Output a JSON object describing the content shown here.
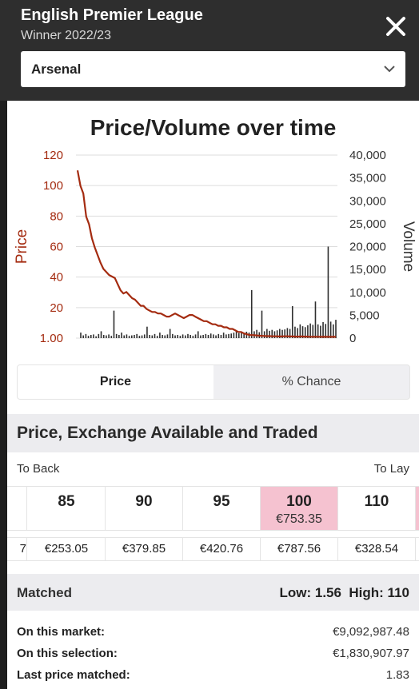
{
  "header": {
    "title": "English Premier League",
    "subtitle": "Winner 2022/23",
    "close_icon": "close-icon",
    "selection": "Arsenal",
    "dropdown_icon": "chevron-down-icon"
  },
  "chart_data": {
    "type": "line",
    "title": "Price/Volume over time",
    "ylabel": "Price",
    "y2label": "Volume",
    "y_ticks": [
      "120",
      "100",
      "80",
      "60",
      "40",
      "20",
      "1.00"
    ],
    "y2_ticks": [
      "40,000",
      "35,000",
      "30,000",
      "25,000",
      "20,000",
      "15,000",
      "10,000",
      "5,000",
      "0"
    ],
    "ylim": [
      1,
      120
    ],
    "y2lim": [
      0,
      40000
    ],
    "grid": true,
    "colors": {
      "price": "#a42b10",
      "volume": "#2f2f2f"
    },
    "series": [
      {
        "values": [
          110,
          100,
          95,
          80,
          75,
          66,
          60,
          55,
          50,
          46,
          44,
          42,
          41,
          40,
          36,
          32,
          30,
          31,
          29,
          27,
          26,
          24,
          22,
          22,
          20,
          19,
          18,
          18,
          17,
          17,
          16,
          15,
          15,
          16,
          17,
          16,
          15,
          14,
          15,
          16,
          16,
          15,
          14,
          13,
          12,
          12,
          11,
          10,
          10,
          9,
          9,
          8,
          8,
          7,
          7,
          6,
          5,
          5,
          4,
          3.5,
          3,
          3,
          2.8,
          2.6,
          2.5,
          2.4,
          2.3,
          2.3,
          2.2,
          2.2,
          2.1,
          2.1,
          2.2,
          2.2,
          2.1,
          2.1,
          2,
          2,
          2.1,
          2,
          2,
          1.9,
          1.9,
          1.9,
          1.9,
          1.85,
          1.85,
          1.85,
          1.84,
          1.84,
          1.83
        ]
      },
      {
        "values": [
          1200,
          600,
          900,
          500,
          700,
          800,
          400,
          900,
          1500,
          700,
          600,
          800,
          500,
          6000,
          900,
          700,
          1200,
          600,
          800,
          500,
          600,
          700,
          900,
          500,
          600,
          800,
          2500,
          700,
          600,
          900,
          500,
          1200,
          700,
          600,
          800,
          2000,
          900,
          600,
          700,
          500,
          800,
          600,
          900,
          700,
          500,
          800,
          1500,
          600,
          700,
          900,
          700,
          1000,
          800,
          600,
          900,
          700,
          1200,
          800,
          900,
          1000,
          1200,
          1500,
          1100,
          1300,
          1000,
          1400,
          1200,
          10500,
          1500,
          1800,
          1300,
          6000,
          1500,
          2000,
          1600,
          1800,
          1500,
          1700,
          2000,
          1800,
          1900,
          2200,
          2000,
          7000,
          2500,
          2200,
          3000,
          2600,
          2400,
          2800,
          3200,
          2900,
          8000,
          3000,
          2700,
          3500,
          3100,
          20000,
          3600,
          3000,
          4000
        ]
      }
    ]
  },
  "toggle": {
    "price_label": "Price",
    "chance_label": "% Chance"
  },
  "exchange": {
    "heading": "Price, Exchange Available and Traded",
    "to_back": "To Back",
    "to_lay": "To Lay",
    "ladder": [
      {
        "price": "85",
        "amount": ""
      },
      {
        "price": "90",
        "amount": ""
      },
      {
        "price": "95",
        "amount": ""
      },
      {
        "price": "100",
        "amount": "€753.35"
      },
      {
        "price": "110",
        "amount": ""
      }
    ],
    "traded_clip": "7",
    "traded": [
      "€253.05",
      "€379.85",
      "€420.76",
      "€787.56",
      "€328.54"
    ]
  },
  "matched": {
    "label": "Matched",
    "range": "Low: 1.56  High: 110",
    "on_market_label": "On this market:",
    "on_market_value": "€9,092,987.48",
    "on_selection_label": "On this selection:",
    "on_selection_value": "€1,830,907.97",
    "last_price_label": "Last price matched:",
    "last_price_value": "1.83"
  }
}
